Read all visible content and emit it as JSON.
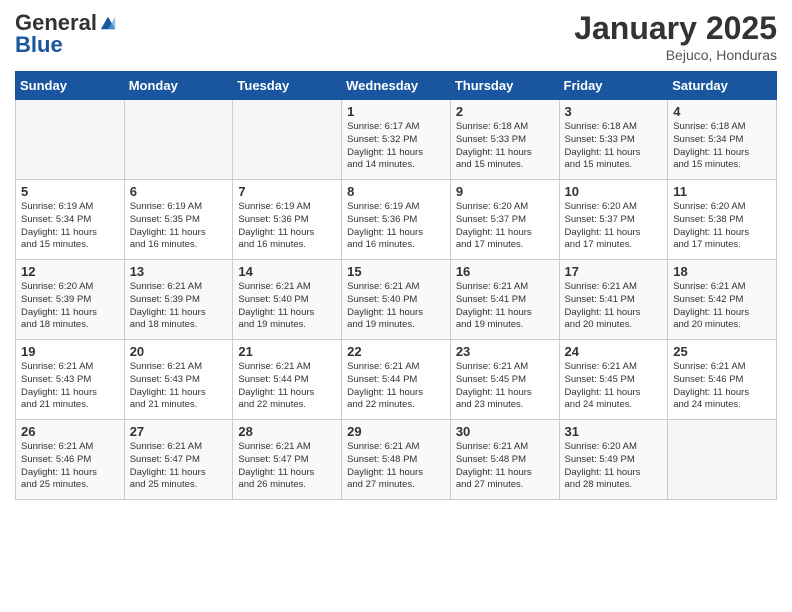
{
  "header": {
    "logo_general": "General",
    "logo_blue": "Blue",
    "month_title": "January 2025",
    "location": "Bejuco, Honduras"
  },
  "days_of_week": [
    "Sunday",
    "Monday",
    "Tuesday",
    "Wednesday",
    "Thursday",
    "Friday",
    "Saturday"
  ],
  "weeks": [
    [
      {
        "day": "",
        "info": ""
      },
      {
        "day": "",
        "info": ""
      },
      {
        "day": "",
        "info": ""
      },
      {
        "day": "1",
        "info": "Sunrise: 6:17 AM\nSunset: 5:32 PM\nDaylight: 11 hours\nand 14 minutes."
      },
      {
        "day": "2",
        "info": "Sunrise: 6:18 AM\nSunset: 5:33 PM\nDaylight: 11 hours\nand 15 minutes."
      },
      {
        "day": "3",
        "info": "Sunrise: 6:18 AM\nSunset: 5:33 PM\nDaylight: 11 hours\nand 15 minutes."
      },
      {
        "day": "4",
        "info": "Sunrise: 6:18 AM\nSunset: 5:34 PM\nDaylight: 11 hours\nand 15 minutes."
      }
    ],
    [
      {
        "day": "5",
        "info": "Sunrise: 6:19 AM\nSunset: 5:34 PM\nDaylight: 11 hours\nand 15 minutes."
      },
      {
        "day": "6",
        "info": "Sunrise: 6:19 AM\nSunset: 5:35 PM\nDaylight: 11 hours\nand 16 minutes."
      },
      {
        "day": "7",
        "info": "Sunrise: 6:19 AM\nSunset: 5:36 PM\nDaylight: 11 hours\nand 16 minutes."
      },
      {
        "day": "8",
        "info": "Sunrise: 6:19 AM\nSunset: 5:36 PM\nDaylight: 11 hours\nand 16 minutes."
      },
      {
        "day": "9",
        "info": "Sunrise: 6:20 AM\nSunset: 5:37 PM\nDaylight: 11 hours\nand 17 minutes."
      },
      {
        "day": "10",
        "info": "Sunrise: 6:20 AM\nSunset: 5:37 PM\nDaylight: 11 hours\nand 17 minutes."
      },
      {
        "day": "11",
        "info": "Sunrise: 6:20 AM\nSunset: 5:38 PM\nDaylight: 11 hours\nand 17 minutes."
      }
    ],
    [
      {
        "day": "12",
        "info": "Sunrise: 6:20 AM\nSunset: 5:39 PM\nDaylight: 11 hours\nand 18 minutes."
      },
      {
        "day": "13",
        "info": "Sunrise: 6:21 AM\nSunset: 5:39 PM\nDaylight: 11 hours\nand 18 minutes."
      },
      {
        "day": "14",
        "info": "Sunrise: 6:21 AM\nSunset: 5:40 PM\nDaylight: 11 hours\nand 19 minutes."
      },
      {
        "day": "15",
        "info": "Sunrise: 6:21 AM\nSunset: 5:40 PM\nDaylight: 11 hours\nand 19 minutes."
      },
      {
        "day": "16",
        "info": "Sunrise: 6:21 AM\nSunset: 5:41 PM\nDaylight: 11 hours\nand 19 minutes."
      },
      {
        "day": "17",
        "info": "Sunrise: 6:21 AM\nSunset: 5:41 PM\nDaylight: 11 hours\nand 20 minutes."
      },
      {
        "day": "18",
        "info": "Sunrise: 6:21 AM\nSunset: 5:42 PM\nDaylight: 11 hours\nand 20 minutes."
      }
    ],
    [
      {
        "day": "19",
        "info": "Sunrise: 6:21 AM\nSunset: 5:43 PM\nDaylight: 11 hours\nand 21 minutes."
      },
      {
        "day": "20",
        "info": "Sunrise: 6:21 AM\nSunset: 5:43 PM\nDaylight: 11 hours\nand 21 minutes."
      },
      {
        "day": "21",
        "info": "Sunrise: 6:21 AM\nSunset: 5:44 PM\nDaylight: 11 hours\nand 22 minutes."
      },
      {
        "day": "22",
        "info": "Sunrise: 6:21 AM\nSunset: 5:44 PM\nDaylight: 11 hours\nand 22 minutes."
      },
      {
        "day": "23",
        "info": "Sunrise: 6:21 AM\nSunset: 5:45 PM\nDaylight: 11 hours\nand 23 minutes."
      },
      {
        "day": "24",
        "info": "Sunrise: 6:21 AM\nSunset: 5:45 PM\nDaylight: 11 hours\nand 24 minutes."
      },
      {
        "day": "25",
        "info": "Sunrise: 6:21 AM\nSunset: 5:46 PM\nDaylight: 11 hours\nand 24 minutes."
      }
    ],
    [
      {
        "day": "26",
        "info": "Sunrise: 6:21 AM\nSunset: 5:46 PM\nDaylight: 11 hours\nand 25 minutes."
      },
      {
        "day": "27",
        "info": "Sunrise: 6:21 AM\nSunset: 5:47 PM\nDaylight: 11 hours\nand 25 minutes."
      },
      {
        "day": "28",
        "info": "Sunrise: 6:21 AM\nSunset: 5:47 PM\nDaylight: 11 hours\nand 26 minutes."
      },
      {
        "day": "29",
        "info": "Sunrise: 6:21 AM\nSunset: 5:48 PM\nDaylight: 11 hours\nand 27 minutes."
      },
      {
        "day": "30",
        "info": "Sunrise: 6:21 AM\nSunset: 5:48 PM\nDaylight: 11 hours\nand 27 minutes."
      },
      {
        "day": "31",
        "info": "Sunrise: 6:20 AM\nSunset: 5:49 PM\nDaylight: 11 hours\nand 28 minutes."
      },
      {
        "day": "",
        "info": ""
      }
    ]
  ]
}
